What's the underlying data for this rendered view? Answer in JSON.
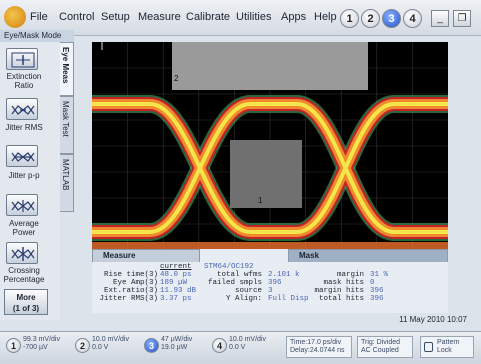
{
  "menu": {
    "items": [
      "File",
      "Control",
      "Setup",
      "Measure",
      "Calibrate",
      "Utilities",
      "Apps",
      "Help"
    ],
    "channels": [
      "1",
      "2",
      "3",
      "4"
    ],
    "active_channel": "3",
    "minimize": "_",
    "restore": "❐"
  },
  "left_panel": {
    "title": "Eye/Mask Mode",
    "buttons": [
      {
        "label": "Extinction Ratio"
      },
      {
        "label": "Jitter RMS"
      },
      {
        "label": "Jitter p-p"
      },
      {
        "label": "Average Power"
      },
      {
        "label": "Crossing Percentage"
      }
    ],
    "more_line1": "More",
    "more_line2": "(1 of 3)"
  },
  "tabs": [
    "Eye Meas",
    "Mask Test",
    "MATLAB"
  ],
  "screen": {
    "mask_label_top": "2",
    "mask_label_center": "1"
  },
  "measure_panel": {
    "measure_tab": "Measure",
    "mask_tab": "Mask",
    "current_header": "current",
    "rows": [
      {
        "label": "Rise time(3)",
        "value": "48.0 ps"
      },
      {
        "label": "Eye Amp(3)",
        "value": "189 µW"
      },
      {
        "label": "Ext.ratio(3)",
        "value": "11.93 dB"
      },
      {
        "label": "Jitter RMS(3)",
        "value": "3.37 ps"
      }
    ],
    "mask": {
      "name": "STM64/OC192",
      "rows": [
        {
          "label": "total wfms",
          "value": "2.101 k",
          "label2": "margin",
          "value2": "31 %"
        },
        {
          "label": "failed smpls",
          "value": "396",
          "label2": "mask hits",
          "value2": "0"
        },
        {
          "label": "source",
          "value": "3",
          "label2": "margin hits",
          "value2": "396"
        },
        {
          "label": "Y Align:",
          "value": "Full Disp",
          "label2": "total hits",
          "value2": "396"
        }
      ]
    }
  },
  "date": "11 May 2010  10:07",
  "bottom_bar": {
    "ch1": {
      "num": "1",
      "line1": "99.3 mV/div",
      "line2": "-700 µV"
    },
    "ch2": {
      "num": "2",
      "line1": "10.0 mV/div",
      "line2": "0.0 V"
    },
    "ch3": {
      "num": "3",
      "line1": "47 µW/div",
      "line2": "19.0 µW"
    },
    "ch4": {
      "num": "4",
      "line1": "10.0 mV/div",
      "line2": "0.0 V"
    },
    "time": {
      "line1": "Time:17.0 ps/div",
      "line2": "Delay:24.0744 ns"
    },
    "trig": {
      "line1": "Trig: Divided",
      "line2": "AC Coupled"
    },
    "pattern": {
      "line1": "Pattern",
      "line2": "Lock"
    }
  },
  "colors": {
    "trace_yellow": "#f4e64a",
    "trace_orange": "#f08a2c",
    "trace_red": "#c4222a",
    "trace_green": "#3f9f5a",
    "mask_gray": "#9a9a9a",
    "active_blue": "#2450c8"
  }
}
